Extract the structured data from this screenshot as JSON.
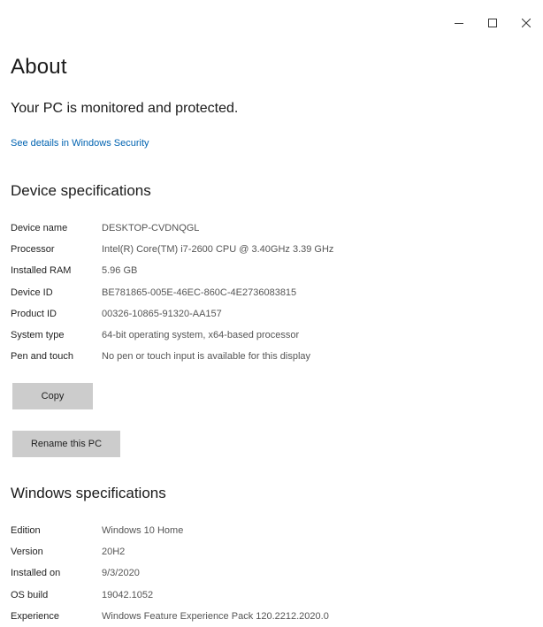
{
  "window": {
    "minimize_label": "–",
    "maximize_label": "□",
    "close_label": "×"
  },
  "page": {
    "title": "About",
    "protection_status": "Your PC is monitored and protected.",
    "security_link": "See details in Windows Security"
  },
  "device_specs": {
    "heading": "Device specifications",
    "rows": [
      {
        "label": "Device name",
        "value": "DESKTOP-CVDNQGL"
      },
      {
        "label": "Processor",
        "value": "Intel(R) Core(TM) i7-2600 CPU @ 3.40GHz   3.39 GHz"
      },
      {
        "label": "Installed RAM",
        "value": "5.96 GB"
      },
      {
        "label": "Device ID",
        "value": "BE781865-005E-46EC-860C-4E2736083815"
      },
      {
        "label": "Product ID",
        "value": "00326-10865-91320-AA157"
      },
      {
        "label": "System type",
        "value": "64-bit operating system, x64-based processor"
      },
      {
        "label": "Pen and touch",
        "value": "No pen or touch input is available for this display"
      }
    ],
    "copy_button": "Copy",
    "rename_button": "Rename this PC"
  },
  "windows_specs": {
    "heading": "Windows specifications",
    "rows": [
      {
        "label": "Edition",
        "value": "Windows 10 Home"
      },
      {
        "label": "Version",
        "value": "20H2"
      },
      {
        "label": "Installed on",
        "value": "9/3/2020"
      },
      {
        "label": "OS build",
        "value": "19042.1052"
      },
      {
        "label": "Experience",
        "value": "Windows Feature Experience Pack 120.2212.2020.0"
      }
    ]
  },
  "colors": {
    "link": "#0063b1",
    "button_bg": "#cccccc"
  }
}
